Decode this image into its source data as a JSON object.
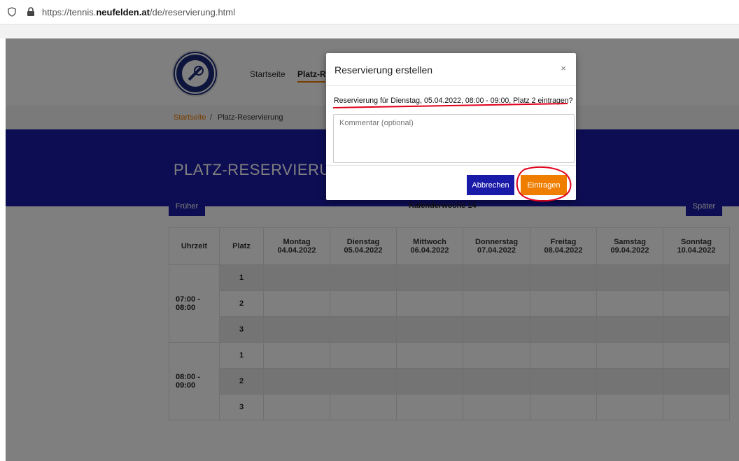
{
  "browser": {
    "url_prefix": "https://tennis.",
    "url_domain": "neufelden.at",
    "url_path": "/de/reservierung.html"
  },
  "nav": {
    "home": "Startseite",
    "platz": "Platz-Re"
  },
  "breadcrumb": {
    "home": "Startseite",
    "separator": "/",
    "current": "Platz-Reservierung"
  },
  "banner": {
    "title": "PLATZ-RESERVIERUN"
  },
  "calendar": {
    "earlier_label": "Früher",
    "later_label": "Später",
    "week_label": "Kalenderwoche 14",
    "headers": {
      "time": "Uhrzeit",
      "court": "Platz",
      "days": [
        {
          "name": "Montag",
          "date": "04.04.2022"
        },
        {
          "name": "Dienstag",
          "date": "05.04.2022"
        },
        {
          "name": "Mittwoch",
          "date": "06.04.2022"
        },
        {
          "name": "Donnerstag",
          "date": "07.04.2022"
        },
        {
          "name": "Freitag",
          "date": "08.04.2022"
        },
        {
          "name": "Samstag",
          "date": "09.04.2022"
        },
        {
          "name": "Sonntag",
          "date": "10.04.2022"
        }
      ]
    },
    "slots": [
      {
        "time": "07:00 -\n08:00",
        "courts": [
          "1",
          "2",
          "3"
        ]
      },
      {
        "time": "08:00 -\n09:00",
        "courts": [
          "1",
          "2",
          "3"
        ]
      }
    ]
  },
  "modal": {
    "title": "Reservierung erstellen",
    "close": "×",
    "message": "Reservierung für Dienstag, 05.04.2022, 08:00 - 09:00, Platz 2 eintragen?",
    "comment_placeholder": "Kommentar (optional)",
    "cancel_label": "Abbrechen",
    "submit_label": "Eintragen"
  },
  "colors": {
    "primary": "#1a1aa8",
    "accent": "#ef7d00",
    "annotation": "#e0001b"
  }
}
